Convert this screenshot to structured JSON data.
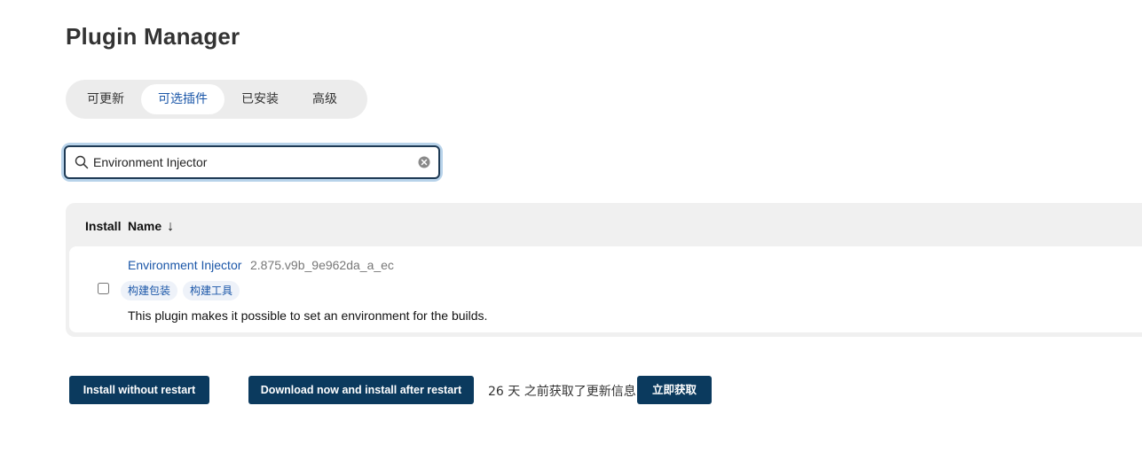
{
  "page": {
    "title": "Plugin Manager"
  },
  "tabs": [
    {
      "label": "可更新",
      "active": false
    },
    {
      "label": "可选插件",
      "active": true
    },
    {
      "label": "已安装",
      "active": false
    },
    {
      "label": "高级",
      "active": false
    }
  ],
  "search": {
    "value": "Environment Injector",
    "icon": "search-icon",
    "clear_icon": "clear-icon"
  },
  "table": {
    "headers": {
      "install": "Install",
      "name": "Name",
      "sort_indicator": "↓"
    },
    "rows": [
      {
        "name": "Environment Injector",
        "version": "2.875.v9b_9e962da_a_ec",
        "tags": [
          "构建包装",
          "构建工具"
        ],
        "description": "This plugin makes it possible to set an environment for the builds.",
        "checked": false
      }
    ]
  },
  "actions": {
    "install_without_restart": "Install without restart",
    "download_install_after_restart": "Download now and install after restart",
    "update_info": "26 天 之前获取了更新信息",
    "fetch_now": "立即获取"
  },
  "colors": {
    "accent": "#1a56a8",
    "button_bg": "#0b3a5e",
    "focus_ring": "#b8d3ea"
  }
}
